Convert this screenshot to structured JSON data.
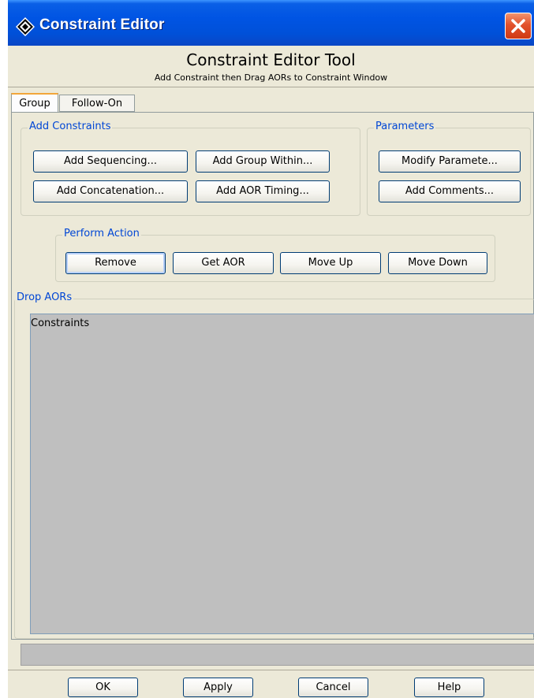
{
  "window": {
    "title": "Constraint Editor"
  },
  "header": {
    "title": "Constraint Editor Tool",
    "subtitle": "Add Constraint then Drag AORs to Constraint Window"
  },
  "tabs": [
    {
      "label": "Group",
      "active": true
    },
    {
      "label": "Follow-On",
      "active": false
    }
  ],
  "add_constraints": {
    "label": "Add Constraints",
    "buttons": [
      "Add Sequencing...",
      "Add Group Within...",
      "Add Concatenation...",
      "Add AOR Timing..."
    ]
  },
  "parameters": {
    "label": "Parameters",
    "buttons": [
      "Modify Paramete...",
      "Add Comments..."
    ]
  },
  "perform_action": {
    "label": "Perform Action",
    "buttons": [
      "Remove",
      "Get AOR",
      "Move Up",
      "Move Down"
    ]
  },
  "drop_aors": {
    "label": "Drop AORs",
    "list_header": "Constraints"
  },
  "footer": {
    "buttons": [
      "OK",
      "Apply",
      "Cancel",
      "Help"
    ]
  },
  "colors": {
    "titlebar": "#0054e3",
    "group_label": "#0046d5",
    "window_bg": "#ece9d8",
    "list_bg": "#bfbfbf",
    "close_button": "#e2512c"
  }
}
